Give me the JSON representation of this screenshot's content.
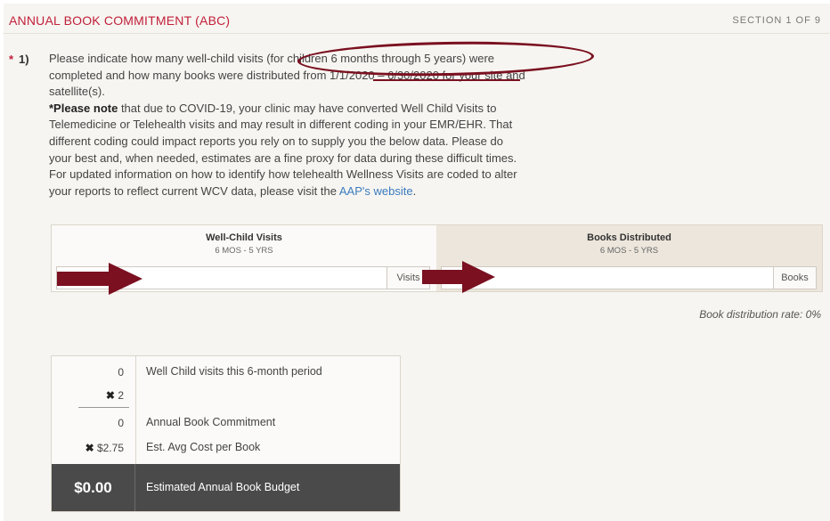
{
  "header": {
    "title": "ANNUAL BOOK COMMITMENT (ABC)",
    "section": "SECTION 1 OF 9"
  },
  "question": {
    "required_mark": "*",
    "number": "1)",
    "line1": "Please indicate how many well-child visits (for children 6 months through 5 years) were",
    "line2": "completed and how many books were distributed from 1/1/2020 – 6/30/2020 for your site and",
    "line3": "satellite(s).",
    "note_bold": "*Please note",
    "note_rest": " that due to COVID-19, your clinic may have converted Well Child Visits to",
    "line5": "Telemedicine or Telehealth visits and may result in different coding in your EMR/EHR. That",
    "line6": "different coding could impact reports you rely on to supply you the below data. Please do",
    "line7": "your best and, when needed, estimates are a fine proxy for data during these difficult times.",
    "line8": "For updated information on how to identify how telehealth Wellness Visits are coded to alter",
    "line9": "your reports to reflect current WCV data, please visit the ",
    "link": "AAP's website",
    "line9_end": "."
  },
  "inputs": {
    "visits": {
      "heading": "Well-Child Visits",
      "subheading": "6 MOS - 5 YRS",
      "value": "",
      "addon": "Visits"
    },
    "books": {
      "heading": "Books Distributed",
      "subheading": "6 MOS - 5 YRS",
      "value": "",
      "addon": "Books"
    }
  },
  "rate_text": "Book distribution rate: 0%",
  "calc": {
    "visits_value": "0",
    "visits_label": "Well Child visits this 6-month period",
    "multiplier_symbol": "✖",
    "multiplier_value": " 2",
    "commitment_value": "0",
    "commitment_label": "Annual Book Commitment",
    "cost_symbol": "✖",
    "cost_value": " $2.75",
    "cost_label": "Est. Avg Cost per Book",
    "total_value": "$0.00",
    "total_label": "Estimated Annual Book Budget"
  },
  "colors": {
    "accent": "#c0203a",
    "annotation": "#7a1020",
    "link": "#3a7bbf",
    "total_bg": "#4a4a4a"
  }
}
